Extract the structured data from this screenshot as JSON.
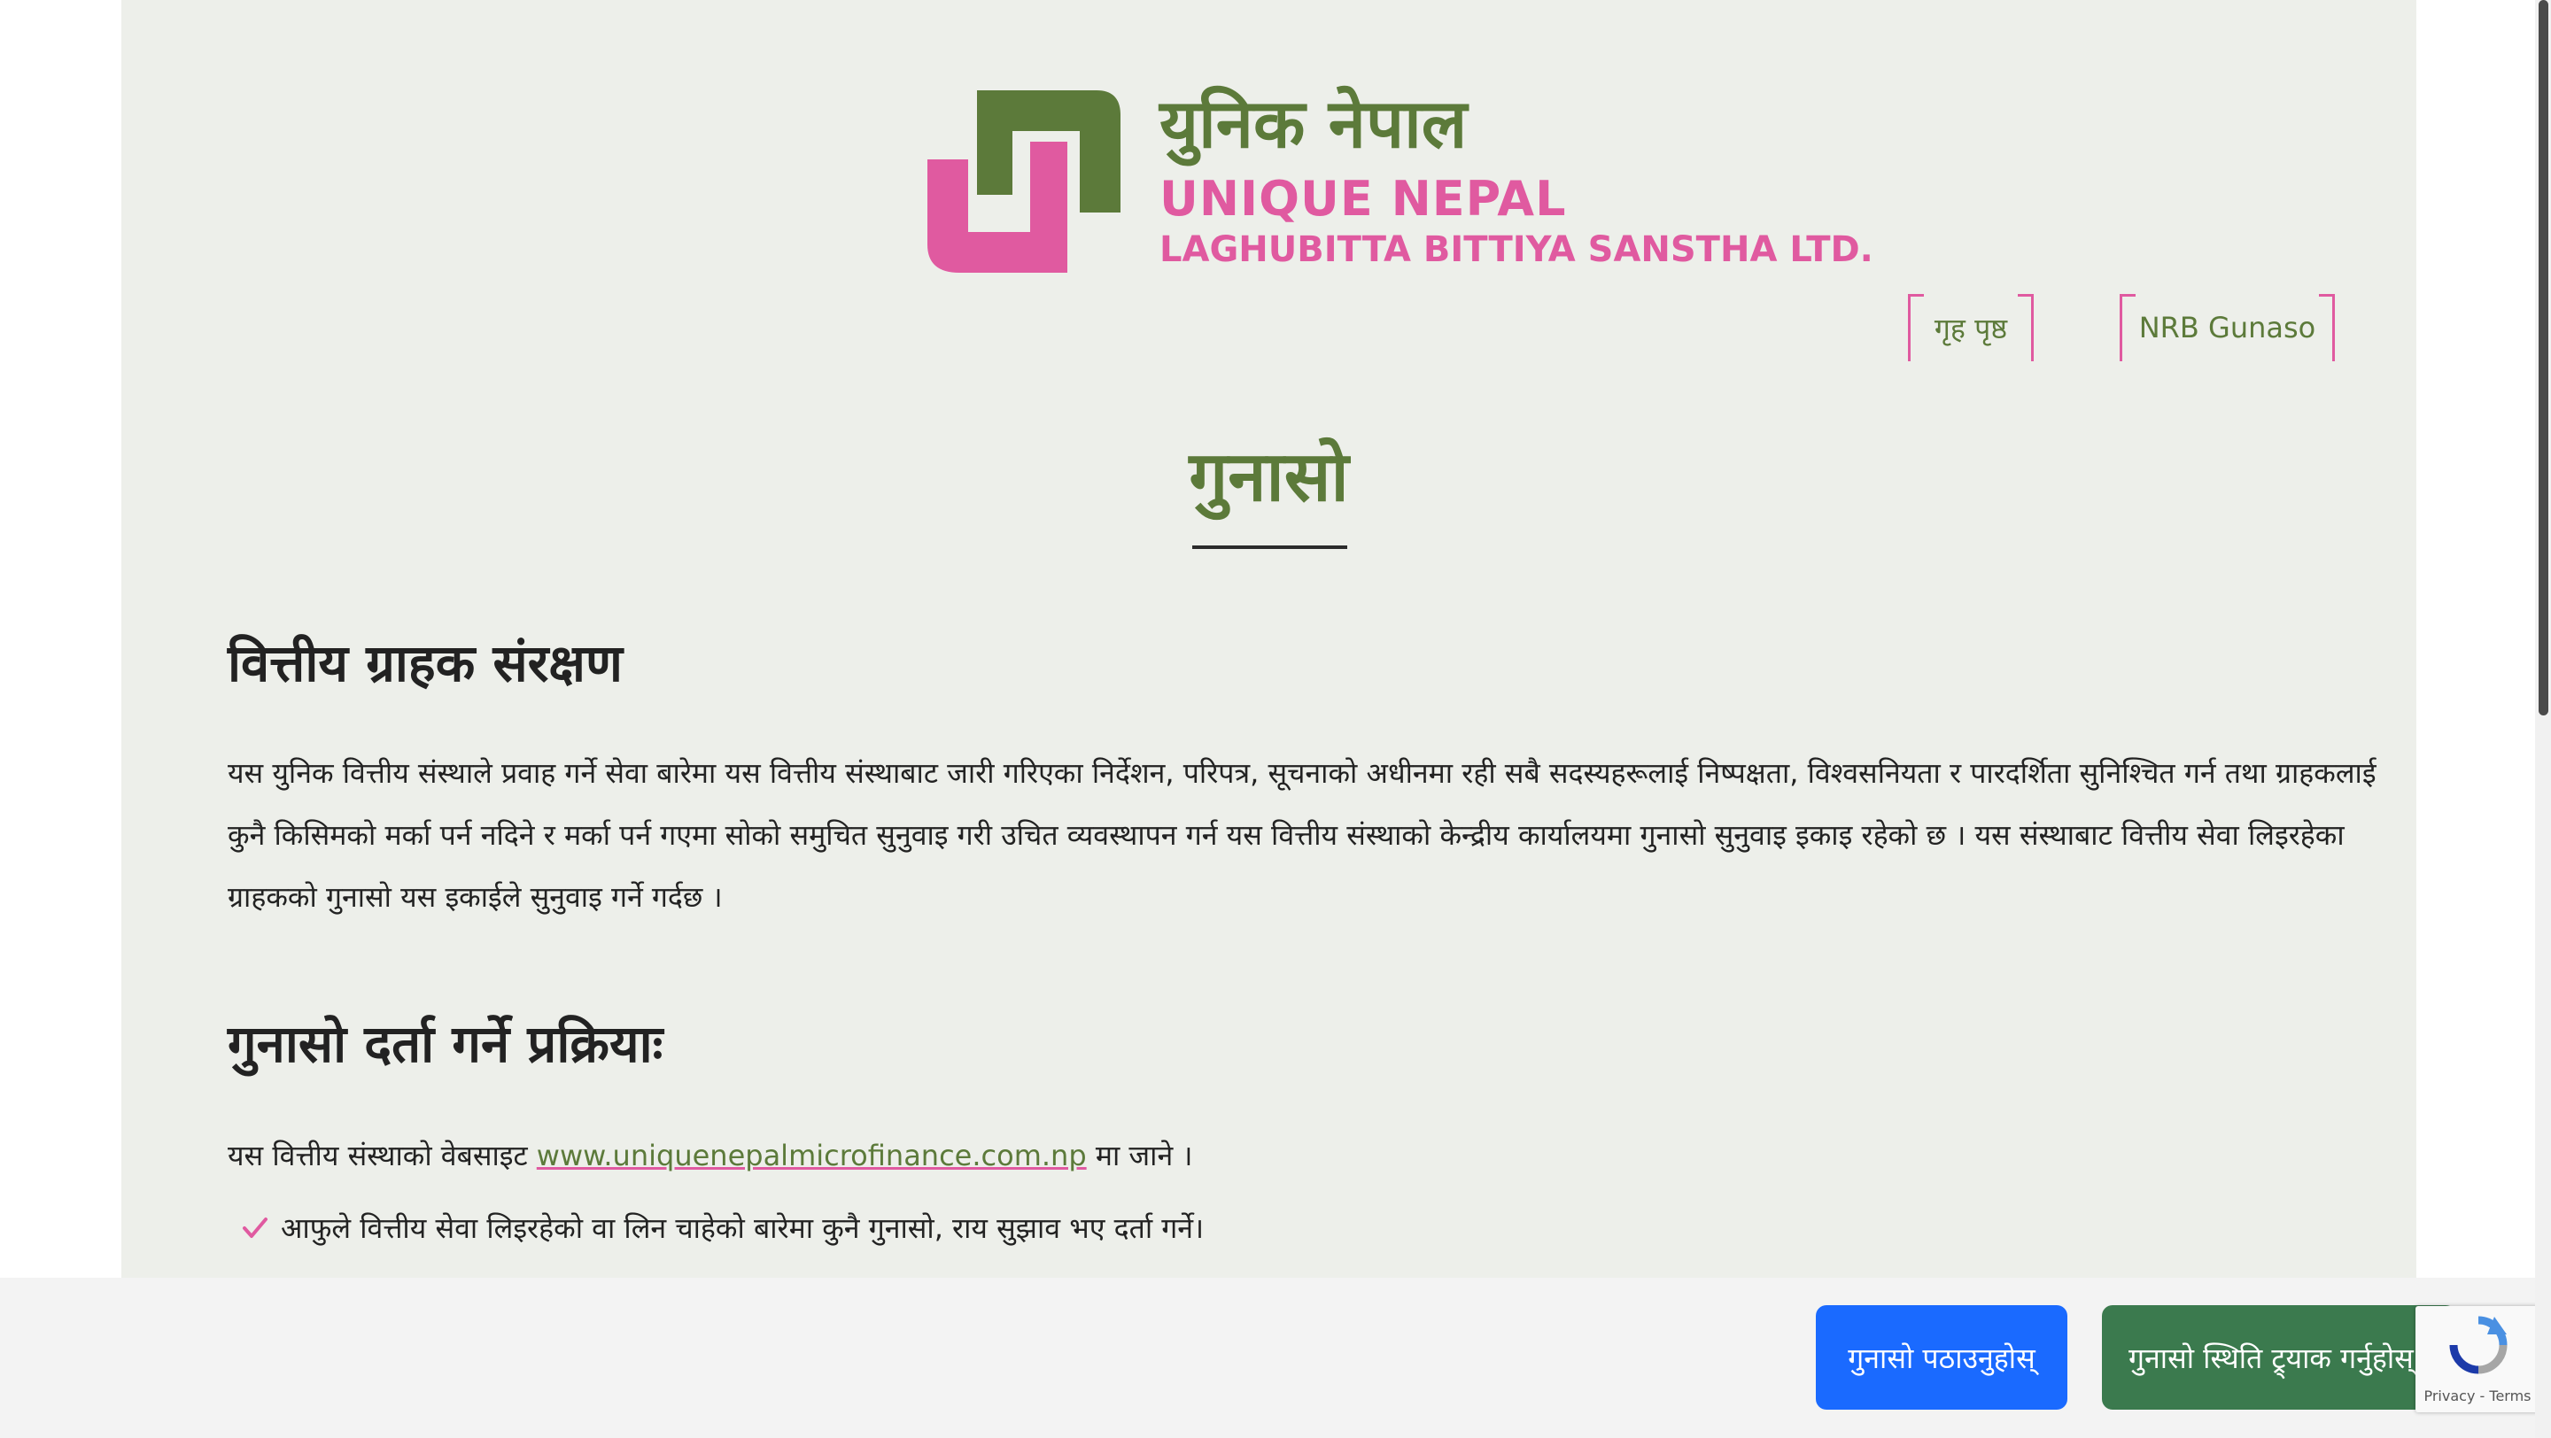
{
  "logo": {
    "name_ne": "युनिक नेपाल",
    "name_en": "UNIQUE NEPAL",
    "tagline_en": "LAGHUBITTA BITTIYA SANSTHA LTD."
  },
  "nav": {
    "home": "गृह पृष्ठ",
    "nrb": "NRB Gunaso"
  },
  "page": {
    "title": "गुनासो"
  },
  "sections": {
    "protection": {
      "heading": "वित्तीय ग्राहक संरक्षण",
      "body": "यस युनिक वित्तीय संस्थाले प्रवाह गर्ने सेवा बारेमा यस वित्तीय संस्थाबाट जारी गरिएका निर्देशन, परिपत्र, सूचनाको अधीनमा रही सबै सदस्यहरूलाई निष्पक्षता, विश्वसनियता र पारदर्शिता सुनिश्चित गर्न तथा ग्राहकलाई कुनै किसिमको मर्का पर्न नदिने र मर्का पर्न गएमा सोको समुचित सुनुवाइ गरी उचित व्यवस्थापन गर्न यस वित्तीय संस्थाको केन्द्रीय कार्यालयमा गुनासो सुनुवाइ इकाइ रहेको छ । यस संस्थाबाट वित्तीय सेवा लिइरहेका ग्राहकको गुनासो यस इकाईले सुनुवाइ गर्ने गर्दछ ।"
    },
    "process": {
      "heading": "गुनासो दर्ता गर्ने प्रक्रियाः",
      "website_prefix": "यस वित्तीय संस्थाको वेबसाइट",
      "website_link": "www.uniquenepalmicrofinance.com.np",
      "website_suffix": "मा जाने ।",
      "steps": [
        "आफुले वित्तीय सेवा लिइरहेको वा लिन चाहेको बारेमा कुनै गुनासो, राय सुझाव भए दर्ता गर्ने।"
      ]
    }
  },
  "actions": {
    "send": "गुनासो पठाउनुहोस्",
    "track": "गुनासो स्थिति ट्र्याक गर्नुहोस्"
  },
  "recaptcha": {
    "privacy": "Privacy",
    "separator": "-",
    "terms": "Terms"
  },
  "colors": {
    "brand_green": "#5c7a3a",
    "brand_pink": "#e05aa0",
    "send_blue": "#1a6aff",
    "track_green": "#3b7a4e",
    "page_bg": "#edefea"
  },
  "icons": {
    "logo_mark": "logo-u-mark-icon",
    "check": "check-icon",
    "recaptcha": "recaptcha-icon"
  }
}
